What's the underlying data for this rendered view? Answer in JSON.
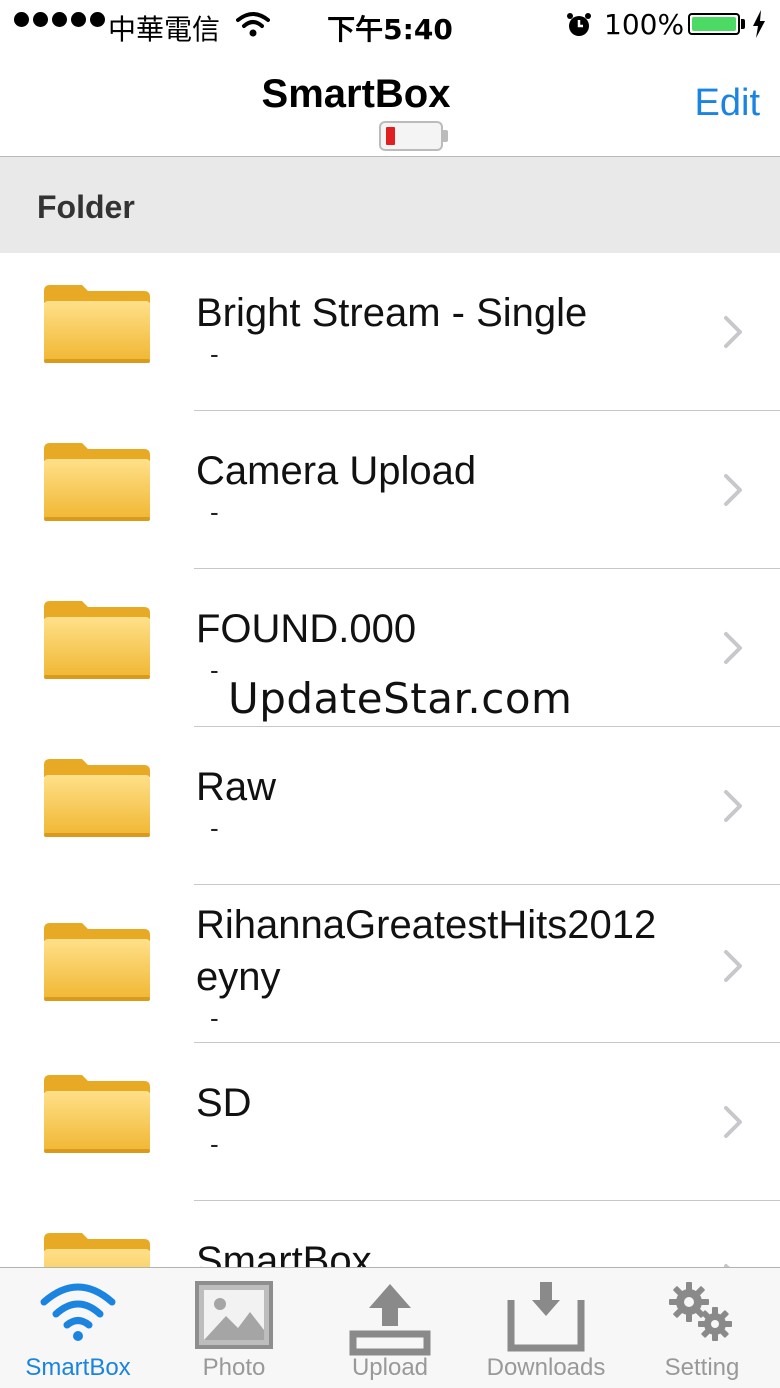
{
  "status_bar": {
    "carrier": "中華電信",
    "time": "下午5:40",
    "battery_percent": "100%"
  },
  "nav": {
    "title": "SmartBox",
    "edit_label": "Edit"
  },
  "section": {
    "header": "Folder"
  },
  "folders": [
    {
      "name": "Bright Stream - Single",
      "sub": "-"
    },
    {
      "name": "Camera Upload",
      "sub": "-"
    },
    {
      "name": "FOUND.000",
      "sub": "-"
    },
    {
      "name": "Raw",
      "sub": "-"
    },
    {
      "name": "RihannaGreatestHits2012eyny",
      "sub": "-"
    },
    {
      "name": "SD",
      "sub": "-"
    },
    {
      "name": "SmartBox",
      "sub": "-"
    }
  ],
  "watermark": "UpdateStar.com",
  "tabs": [
    {
      "label": "SmartBox",
      "icon": "wifi-icon",
      "active": true
    },
    {
      "label": "Photo",
      "icon": "photo-icon",
      "active": false
    },
    {
      "label": "Upload",
      "icon": "upload-icon",
      "active": false
    },
    {
      "label": "Downloads",
      "icon": "download-icon",
      "active": false
    },
    {
      "label": "Setting",
      "icon": "gear-icon",
      "active": false
    }
  ],
  "colors": {
    "accent": "#1a84e0",
    "section_bg": "#e9e9e9",
    "folder": "#f5c243",
    "battery_low": "#e02020"
  }
}
